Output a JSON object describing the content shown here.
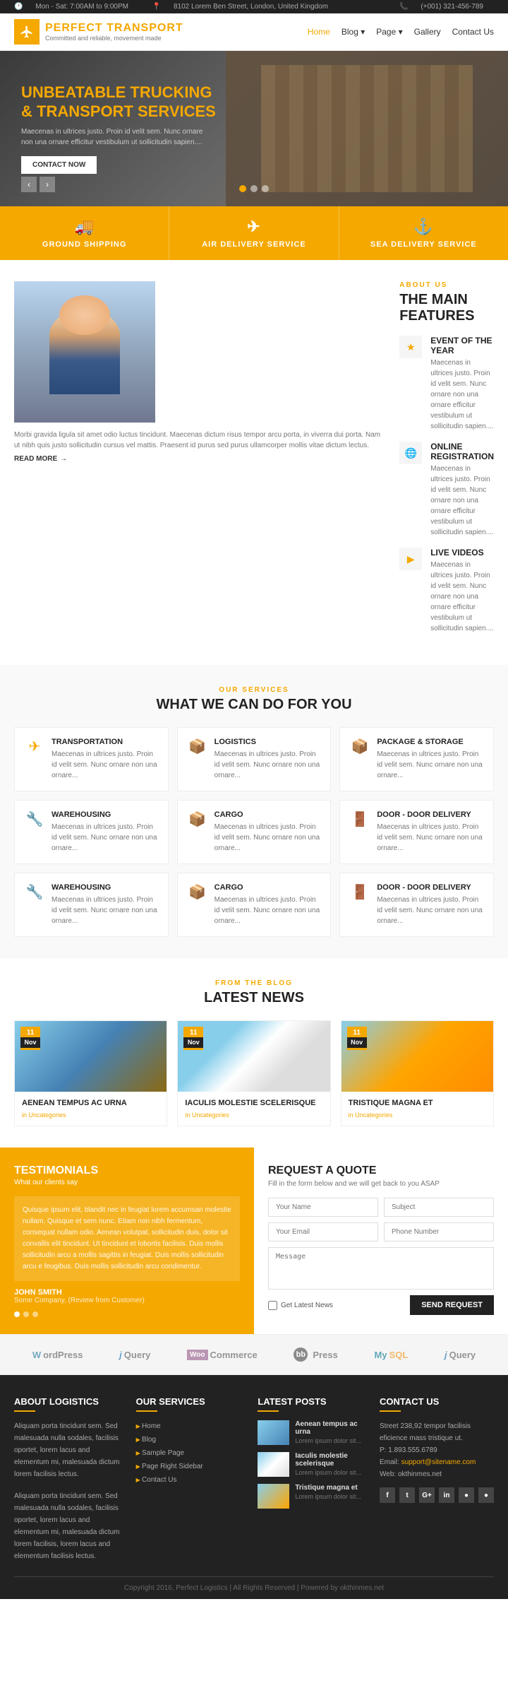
{
  "topbar": {
    "hours": "Mon - Sat: 7:00AM to 9:00PM",
    "address": "8102 Lorem Ben Street, London, United Kingdom",
    "phone": "(+001) 321-456-789"
  },
  "header": {
    "logo_text": "PERFECT TRANSPORT",
    "logo_sub": "Committed and reliable, movement made",
    "nav": [
      {
        "label": "Home",
        "active": true
      },
      {
        "label": "Blog"
      },
      {
        "label": "Page"
      },
      {
        "label": "Gallery"
      },
      {
        "label": "Contact Us"
      }
    ]
  },
  "hero": {
    "line1": "UNBEATABLE",
    "highlight": "TRUCKING",
    "line2": "& TRANSPORT SERVICES",
    "desc": "Maecenas in ultrices justo. Proin id velit sem. Nunc ornare non una ornare efficitur vestibulum ut sollicitudin sapien....",
    "cta": "CONTACT NOW",
    "dots": [
      1,
      2,
      3
    ]
  },
  "services_bar": [
    {
      "icon": "🚚",
      "label": "GROUND SHIPPING"
    },
    {
      "icon": "✈",
      "label": "AIR DELIVERY SERVICE"
    },
    {
      "icon": "⚓",
      "label": "SEA DELIVERY SERVICE"
    }
  ],
  "about": {
    "label": "ABOUT US",
    "title": "THE MAIN FEATURES",
    "img_desc": "Morbi gravida ligula sit amet odio luctus tincidunt. Maecenas dictum risus tempor arcu porta, in viverra dui porta. Nam ut nibh quis justo sollicitudin cursus vel mattis. Praesent id purus sed purus ullamcorper mollis vitae dictum lectus.",
    "read_more": "READ MORE",
    "features": [
      {
        "icon": "★",
        "title": "EVENT OF THE YEAR",
        "desc": "Maecenas in ultrices justo. Proin id velit sem. Nunc ornare non una ornare efficitur vestibulum ut sollicitudin sapien...."
      },
      {
        "icon": "🌐",
        "title": "ONLINE REGISTRATION",
        "desc": "Maecenas in ultrices justo. Proin id velit sem. Nunc ornare non una ornare efficitur vestibulum ut sollicitudin sapien...."
      },
      {
        "icon": "▶",
        "title": "LIVE VIDEOS",
        "desc": "Maecenas in ultrices justo. Proin id velit sem. Nunc ornare non una ornare efficitur vestibulum ut sollicitudin sapien...."
      }
    ]
  },
  "what_section": {
    "label": "OUR SERVICES",
    "title": "WHAT WE CAN DO FOR YOU",
    "cards": [
      {
        "icon": "✈",
        "title": "TRANSPORTATION",
        "desc": "Maecenas in ultrices justo. Proin id velit sem. Nunc ornare non una ornare..."
      },
      {
        "icon": "📦",
        "title": "LOGISTICS",
        "desc": "Maecenas in ultrices justo. Proin id velit sem. Nunc ornare non una ornare..."
      },
      {
        "icon": "📦",
        "title": "PACKAGE & STORAGE",
        "desc": "Maecenas in ultrices justo. Proin id velit sem. Nunc ornare non una ornare..."
      },
      {
        "icon": "🔧",
        "title": "WAREHOUSING",
        "desc": "Maecenas in ultrices justo. Proin id velit sem. Nunc ornare non una ornare..."
      },
      {
        "icon": "📦",
        "title": "CARGO",
        "desc": "Maecenas in ultrices justo. Proin id velit sem. Nunc ornare non una ornare..."
      },
      {
        "icon": "🚪",
        "title": "DOOR - DOOR DELIVERY",
        "desc": "Maecenas in ultrices justo. Proin id velit sem. Nunc ornare non una ornare..."
      },
      {
        "icon": "🔧",
        "title": "WAREHOUSING",
        "desc": "Maecenas in ultrices justo. Proin id velit sem. Nunc ornare non una ornare..."
      },
      {
        "icon": "📦",
        "title": "CARGO",
        "desc": "Maecenas in ultrices justo. Proin id velit sem. Nunc ornare non una ornare..."
      },
      {
        "icon": "🚪",
        "title": "DOOR - DOOR DELIVERY",
        "desc": "Maecenas in ultrices justo. Proin id velit sem. Nunc ornare non una ornare..."
      }
    ]
  },
  "news_section": {
    "label": "FROM THE BLOG",
    "title": "LATEST NEWS",
    "cards": [
      {
        "day": "11",
        "month": "Nov",
        "title": "AENEAN TEMPUS AC URNA",
        "category": "Uncategories"
      },
      {
        "day": "11",
        "month": "Nov",
        "title": "IACULIS MOLESTIE SCELERISQUE",
        "category": "Uncategories"
      },
      {
        "day": "11",
        "month": "Nov",
        "title": "TRISTIQUE MAGNA ET",
        "category": "Uncategories"
      }
    ]
  },
  "testimonials": {
    "label": "TESTIMONIALS",
    "sublabel": "What our clients say",
    "text": "Quisque ipsum elit, blandit nec in feugiat lorem accumsan molestie nullam. Quisque et sem nunc. Etiam non nibh fermentum, consequat nullam odio. Aenean volutpat, sollicitudin duis, dolor sit convallis elit tincidunt. Ut tincidunt et lobortis facilisis. Duis mollis sollicitudin arcu a mollis sagittis in feugiat. Duis mollis sollicitudin arcu e feugibus. Duis mollis sollicitudin arcu condimentur.",
    "name": "JOHN SMITH",
    "company": "Some Company, (Review from Customer)"
  },
  "quote": {
    "title": "REQUEST A QUOTE",
    "desc": "Fill in the form below and we will get back to you ASAP",
    "fields": {
      "name": "Your Name",
      "subject": "Subject",
      "email": "Your Email",
      "phone": "Phone Number",
      "message": "Message"
    },
    "newsletter": "Get Latest News",
    "submit": "SEND REQUEST"
  },
  "partners": [
    "WordPress",
    "jQuery",
    "WooCommerce",
    "bbPress",
    "MySQL",
    "jQuery"
  ],
  "footer": {
    "about_col": {
      "title": "ABOUT LOGISTICS",
      "text1": "Aliquam porta tincidunt sem. Sed malesuada nulla sodales, facilisis oportet, lorem lacus and elementum mi, malesuada dictum lorem facilisis lectus.",
      "text2": "Aliquam porta tincidunt sem. Sed malesuada nulla sodales, facilisis oportet, lorem lacus and elementum mi, malesuada dictum lorem facilisis, lorem lacus and elementum facilisis lectus."
    },
    "services_col": {
      "title": "OUR SERVICES",
      "links": [
        "Home",
        "Blog",
        "Sample Page",
        "Page Right Sidebar",
        "Contact Us"
      ]
    },
    "posts_col": {
      "title": "LATEST POSTS",
      "posts": [
        {
          "title": "Aenean tempus ac urna",
          "date": "Lorem ipsum dolor sit..."
        },
        {
          "title": "Iaculis molestie scelerisque",
          "date": "Lorem ipsum dolor sit..."
        },
        {
          "title": "Tristique magna et",
          "date": "Lorem ipsum dolor sit..."
        }
      ]
    },
    "contact_col": {
      "title": "CONTACT US",
      "address": "Street 238,92 tempor facilisis eficience mass tristique ut.",
      "phone": "P: 1.893.555.6789",
      "email": "support@sitename.com",
      "web": "Web: okthinmes.net",
      "social": [
        "f",
        "t",
        "G+",
        "in",
        "●",
        "●"
      ]
    },
    "copyright": "Copyright 2016, Perfect Logistics | All Rights Reserved | Powered by okthinmes.net"
  }
}
